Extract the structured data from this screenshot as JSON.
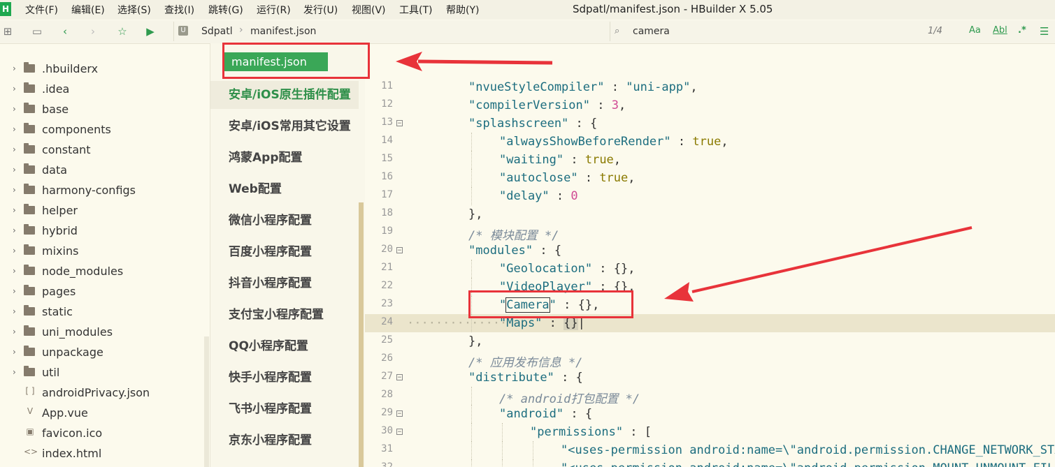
{
  "app": {
    "window_title": "Sdpatl/manifest.json - HBuilder X 5.05",
    "logo": "H",
    "menu": [
      "文件(F)",
      "编辑(E)",
      "选择(S)",
      "查找(I)",
      "跳转(G)",
      "运行(R)",
      "发行(U)",
      "视图(V)",
      "工具(T)",
      "帮助(Y)"
    ]
  },
  "toolbar": {
    "breadcrumb_project": "Sdpatl",
    "breadcrumb_file": "manifest.json",
    "breadcrumb_sep": "›",
    "project_badge": "U",
    "search_value": "camera",
    "match_count": "1/4",
    "opt_case": "Aa",
    "opt_word": "Abl",
    "opt_regex": ".*",
    "menu_more": "☰"
  },
  "tree": {
    "items": [
      {
        "label": ".hbuilderx",
        "type": "folder"
      },
      {
        "label": ".idea",
        "type": "folder"
      },
      {
        "label": "base",
        "type": "folder"
      },
      {
        "label": "components",
        "type": "folder"
      },
      {
        "label": "constant",
        "type": "folder"
      },
      {
        "label": "data",
        "type": "folder"
      },
      {
        "label": "harmony-configs",
        "type": "folder"
      },
      {
        "label": "helper",
        "type": "folder"
      },
      {
        "label": "hybrid",
        "type": "folder"
      },
      {
        "label": "mixins",
        "type": "folder"
      },
      {
        "label": "node_modules",
        "type": "folder"
      },
      {
        "label": "pages",
        "type": "folder"
      },
      {
        "label": "static",
        "type": "folder"
      },
      {
        "label": "uni_modules",
        "type": "folder"
      },
      {
        "label": "unpackage",
        "type": "folder"
      },
      {
        "label": "util",
        "type": "folder"
      },
      {
        "label": "androidPrivacy.json",
        "type": "json",
        "glyph": "[ ]"
      },
      {
        "label": "App.vue",
        "type": "vue",
        "glyph": "V"
      },
      {
        "label": "favicon.ico",
        "type": "image",
        "glyph": "▣"
      },
      {
        "label": "index.html",
        "type": "html",
        "glyph": "<>"
      }
    ]
  },
  "manifest_panel": {
    "tab_label": "manifest.json",
    "items": [
      {
        "label": "安卓/iOS原生插件配置",
        "active": true
      },
      {
        "label": "安卓/iOS常用其它设置",
        "active": false
      },
      {
        "label": "鸿蒙App配置",
        "active": false
      },
      {
        "label": "Web配置",
        "active": false
      },
      {
        "label": "微信小程序配置",
        "active": false
      },
      {
        "label": "百度小程序配置",
        "active": false
      },
      {
        "label": "抖音小程序配置",
        "active": false
      },
      {
        "label": "支付宝小程序配置",
        "active": false
      },
      {
        "label": "QQ小程序配置",
        "active": false
      },
      {
        "label": "快手小程序配置",
        "active": false
      },
      {
        "label": "飞书小程序配置",
        "active": false
      },
      {
        "label": "京东小程序配置",
        "active": false
      }
    ]
  },
  "editor": {
    "current_line": 24,
    "lines": [
      {
        "n": "11",
        "fold": false,
        "html": "<span class=\"key\">\"nvueStyleCompiler\"</span> : <span class=\"str\">\"uni-app\"</span>,",
        "indent": 1
      },
      {
        "n": "12",
        "fold": false,
        "html": "<span class=\"key\">\"compilerVersion\"</span> : <span class=\"num\">3</span>,",
        "indent": 1
      },
      {
        "n": "13",
        "fold": true,
        "html": "<span class=\"key\">\"splashscreen\"</span> : {",
        "indent": 1
      },
      {
        "n": "14",
        "fold": false,
        "html": "<span class=\"key\">\"alwaysShowBeforeRender\"</span> : <span class=\"kw\">true</span>,",
        "indent": 2
      },
      {
        "n": "15",
        "fold": false,
        "html": "<span class=\"key\">\"waiting\"</span> : <span class=\"kw\">true</span>,",
        "indent": 2
      },
      {
        "n": "16",
        "fold": false,
        "html": "<span class=\"key\">\"autoclose\"</span> : <span class=\"kw\">true</span>,",
        "indent": 2
      },
      {
        "n": "17",
        "fold": false,
        "html": "<span class=\"key\">\"delay\"</span> : <span class=\"num\">0</span>",
        "indent": 2
      },
      {
        "n": "18",
        "fold": false,
        "html": "},",
        "indent": 1
      },
      {
        "n": "19",
        "fold": false,
        "html": "<span class=\"cmt\">/* 模块配置 */</span>",
        "indent": 1
      },
      {
        "n": "20",
        "fold": true,
        "html": "<span class=\"key\">\"modules\"</span> : {",
        "indent": 1
      },
      {
        "n": "21",
        "fold": false,
        "html": "<span class=\"key\">\"Geolocation\"</span> : {},",
        "indent": 2
      },
      {
        "n": "22",
        "fold": false,
        "html": "<span class=\"key\">\"VideoPlayer\"</span> : {},",
        "indent": 2
      },
      {
        "n": "23",
        "fold": false,
        "html": "<span class=\"key\">\"<span class=\"found\">Camera</span>\"</span> : {},",
        "indent": 2
      },
      {
        "n": "24",
        "fold": false,
        "html": "<span class=\"key\">\"Maps\"</span> : <span class=\"bracket\">{}</span>|",
        "indent": 2
      },
      {
        "n": "25",
        "fold": false,
        "html": "},",
        "indent": 1
      },
      {
        "n": "26",
        "fold": false,
        "html": "<span class=\"cmt\">/* 应用发布信息 */</span>",
        "indent": 1
      },
      {
        "n": "27",
        "fold": true,
        "html": "<span class=\"key\">\"distribute\"</span> : {",
        "indent": 1
      },
      {
        "n": "28",
        "fold": false,
        "html": "<span class=\"cmt\">/* android打包配置 */</span>",
        "indent": 2
      },
      {
        "n": "29",
        "fold": true,
        "html": "<span class=\"key\">\"android\"</span> : {",
        "indent": 2
      },
      {
        "n": "30",
        "fold": true,
        "html": "<span class=\"key\">\"permissions\"</span> : [",
        "indent": 3
      },
      {
        "n": "31",
        "fold": false,
        "html": "<span class=\"str\">\"&lt;uses-permission android:name=\\\"android.permission.CHANGE_NETWORK_STATE\\\"/&gt;\"</span>,",
        "indent": 4
      },
      {
        "n": "32",
        "fold": false,
        "html": "<span class=\"str\">\"&lt;uses-permission android:name=\\\"android.permission.MOUNT_UNMOUNT_FILESYSTEMS\\\"/&gt;\"</span>,",
        "indent": 4
      }
    ]
  },
  "colors": {
    "accent_green": "#3aa757",
    "annotation_red": "#e8333a",
    "editor_bg": "#fcfaed"
  }
}
